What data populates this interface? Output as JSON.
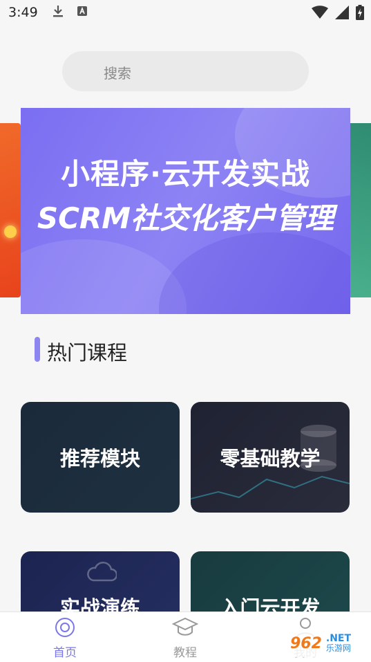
{
  "status_bar": {
    "time": "3:49"
  },
  "search": {
    "placeholder": "搜索"
  },
  "banner": {
    "line1": "小程序·云开发实战",
    "line2": "SCRM社交化客户管理"
  },
  "section": {
    "title": "热门课程"
  },
  "courses": [
    {
      "label": "推荐模块"
    },
    {
      "label": "零基础教学"
    },
    {
      "label": "实战演练"
    },
    {
      "label": "入门云开发"
    }
  ],
  "tabbar": {
    "items": [
      {
        "label": "首页",
        "icon": "home-icon",
        "active": true
      },
      {
        "label": "教程",
        "icon": "graduation-cap-icon",
        "active": false
      },
      {
        "label": "我的",
        "icon": "person-icon",
        "active": false
      }
    ]
  },
  "watermark": {
    "num": "962",
    "net": ".NET",
    "cn": "乐游网"
  },
  "colors": {
    "accent": "#7a78e8",
    "banner": "#7b6ef2"
  }
}
